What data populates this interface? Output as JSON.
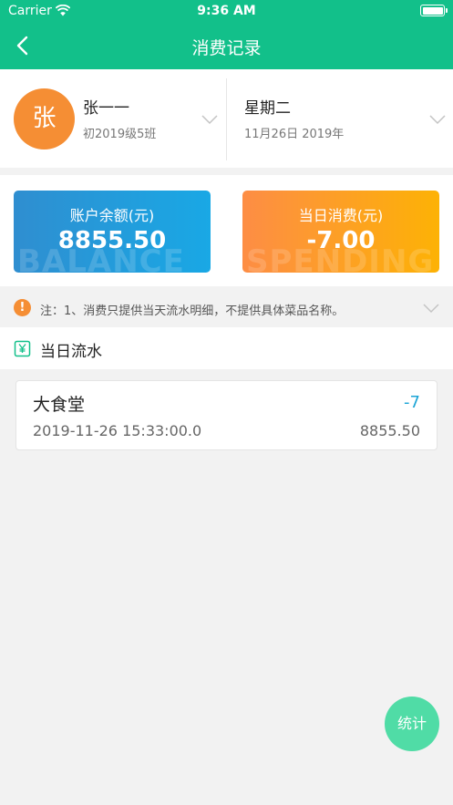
{
  "status_bar": {
    "carrier": "Carrier",
    "time": "9:36 AM"
  },
  "nav": {
    "title": "消费记录",
    "back_icon": "chevron-left-icon"
  },
  "user": {
    "avatar_text": "张",
    "name": "张一一",
    "class": "初2019级5班"
  },
  "day": {
    "weekday": "星期二",
    "date": "11月26日  2019年"
  },
  "cards": {
    "balance": {
      "label": "账户余额(元)",
      "value": "8855.50",
      "watermark": "BALANCE"
    },
    "spending": {
      "label": "当日消费(元)",
      "value": "-7.00",
      "watermark": "SPENDING"
    }
  },
  "notice": {
    "icon_text": "!",
    "text": "注：1、消费只提供当天流水明细，不提供具体菜品名称。"
  },
  "flow": {
    "title": "当日流水"
  },
  "records": [
    {
      "place": "大食堂",
      "amount": "-7",
      "time": "2019-11-26 15:33:00.0",
      "balance": "8855.50"
    }
  ],
  "fab": {
    "label": "统计"
  },
  "colors": {
    "primary": "#12c08a",
    "avatar": "#f58e34",
    "balance_card": "#1e9ddc",
    "spending_card": "#fda11f",
    "amount": "#1ca5d6",
    "fab": "#50dca6"
  }
}
